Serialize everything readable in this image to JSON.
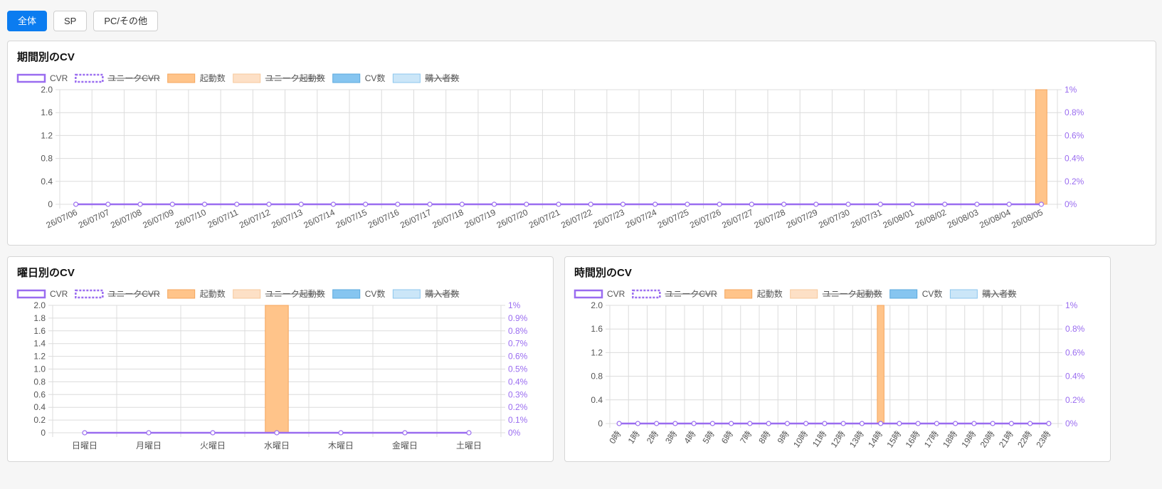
{
  "tabs": [
    {
      "label": "全体",
      "active": true
    },
    {
      "label": "SP",
      "active": false
    },
    {
      "label": "PC/その他",
      "active": false
    }
  ],
  "legend": [
    {
      "label": "CVR",
      "style": "line",
      "color": "#9a6cf0",
      "hidden": false
    },
    {
      "label": "ユニークCVR",
      "style": "dotted",
      "color": "#9a6cf0",
      "hidden": true
    },
    {
      "label": "起動数",
      "style": "box",
      "color": "#ffc48a",
      "hidden": false
    },
    {
      "label": "ユニーク起動数",
      "style": "box",
      "color": "#fde0c6",
      "hidden": true
    },
    {
      "label": "CV数",
      "style": "box",
      "color": "#86c5f0",
      "hidden": false
    },
    {
      "label": "購入者数",
      "style": "box",
      "color": "#cbe6f8",
      "hidden": true
    }
  ],
  "colors": {
    "cvr": "#9a6cf0",
    "bar": "#ffc48a",
    "bar_border": "#f4a55c",
    "grid": "#dcdcdc"
  },
  "charts": {
    "period": {
      "title": "期間別のCV",
      "chart_data": {
        "type": "bar",
        "categories": [
          "26/07/06",
          "26/07/07",
          "26/07/08",
          "26/07/09",
          "26/07/10",
          "26/07/11",
          "26/07/12",
          "26/07/13",
          "26/07/14",
          "26/07/15",
          "26/07/16",
          "26/07/17",
          "26/07/18",
          "26/07/19",
          "26/07/20",
          "26/07/21",
          "26/07/22",
          "26/07/23",
          "26/07/24",
          "26/07/25",
          "26/07/26",
          "26/07/27",
          "26/07/28",
          "26/07/29",
          "26/07/30",
          "26/07/31",
          "26/08/01",
          "26/08/02",
          "26/08/03",
          "26/08/04",
          "26/08/05"
        ],
        "series": [
          {
            "name": "起動数",
            "type": "bar",
            "values": [
              0,
              0,
              0,
              0,
              0,
              0,
              0,
              0,
              0,
              0,
              0,
              0,
              0,
              0,
              0,
              0,
              0,
              0,
              0,
              0,
              0,
              0,
              0,
              0,
              0,
              0,
              0,
              0,
              0,
              0,
              2
            ]
          },
          {
            "name": "CVR",
            "type": "line",
            "axis": "right",
            "values": [
              0,
              0,
              0,
              0,
              0,
              0,
              0,
              0,
              0,
              0,
              0,
              0,
              0,
              0,
              0,
              0,
              0,
              0,
              0,
              0,
              0,
              0,
              0,
              0,
              0,
              0,
              0,
              0,
              0,
              0,
              0
            ]
          }
        ],
        "ylim": [
          0,
          2.0
        ],
        "yticks": [
          "0",
          "0.4",
          "0.8",
          "1.2",
          "1.6",
          "2.0"
        ],
        "y2lim": [
          0,
          1
        ],
        "y2ticks": [
          "0%",
          "0.2%",
          "0.4%",
          "0.6%",
          "0.8%",
          "1%"
        ],
        "grid": true,
        "legend": "top-left"
      }
    },
    "weekday": {
      "title": "曜日別のCV",
      "chart_data": {
        "type": "bar",
        "categories": [
          "日曜日",
          "月曜日",
          "火曜日",
          "水曜日",
          "木曜日",
          "金曜日",
          "土曜日"
        ],
        "series": [
          {
            "name": "起動数",
            "type": "bar",
            "values": [
              0,
              0,
              0,
              2,
              0,
              0,
              0
            ]
          },
          {
            "name": "CVR",
            "type": "line",
            "axis": "right",
            "values": [
              0,
              0,
              0,
              0,
              0,
              0,
              0
            ]
          }
        ],
        "ylim": [
          0,
          2.0
        ],
        "yticks": [
          "0",
          "0.2",
          "0.4",
          "0.6",
          "0.8",
          "1.0",
          "1.2",
          "1.4",
          "1.6",
          "1.8",
          "2.0"
        ],
        "y2lim": [
          0,
          1
        ],
        "y2ticks": [
          "0%",
          "0.1%",
          "0.2%",
          "0.3%",
          "0.4%",
          "0.5%",
          "0.6%",
          "0.7%",
          "0.8%",
          "0.9%",
          "1%"
        ],
        "grid": true,
        "legend": "top-left"
      }
    },
    "hourly": {
      "title": "時間別のCV",
      "chart_data": {
        "type": "bar",
        "categories": [
          "0時",
          "1時",
          "2時",
          "3時",
          "4時",
          "5時",
          "6時",
          "7時",
          "8時",
          "9時",
          "10時",
          "11時",
          "12時",
          "13時",
          "14時",
          "15時",
          "16時",
          "17時",
          "18時",
          "19時",
          "20時",
          "21時",
          "22時",
          "23時"
        ],
        "series": [
          {
            "name": "起動数",
            "type": "bar",
            "values": [
              0,
              0,
              0,
              0,
              0,
              0,
              0,
              0,
              0,
              0,
              0,
              0,
              0,
              0,
              2,
              0,
              0,
              0,
              0,
              0,
              0,
              0,
              0,
              0
            ]
          },
          {
            "name": "CVR",
            "type": "line",
            "axis": "right",
            "values": [
              0,
              0,
              0,
              0,
              0,
              0,
              0,
              0,
              0,
              0,
              0,
              0,
              0,
              0,
              0,
              0,
              0,
              0,
              0,
              0,
              0,
              0,
              0,
              0
            ]
          }
        ],
        "ylim": [
          0,
          2.0
        ],
        "yticks": [
          "0",
          "0.4",
          "0.8",
          "1.2",
          "1.6",
          "2.0"
        ],
        "y2lim": [
          0,
          1
        ],
        "y2ticks": [
          "0%",
          "0.2%",
          "0.4%",
          "0.6%",
          "0.8%",
          "1%"
        ],
        "grid": true,
        "legend": "top-left"
      }
    }
  }
}
